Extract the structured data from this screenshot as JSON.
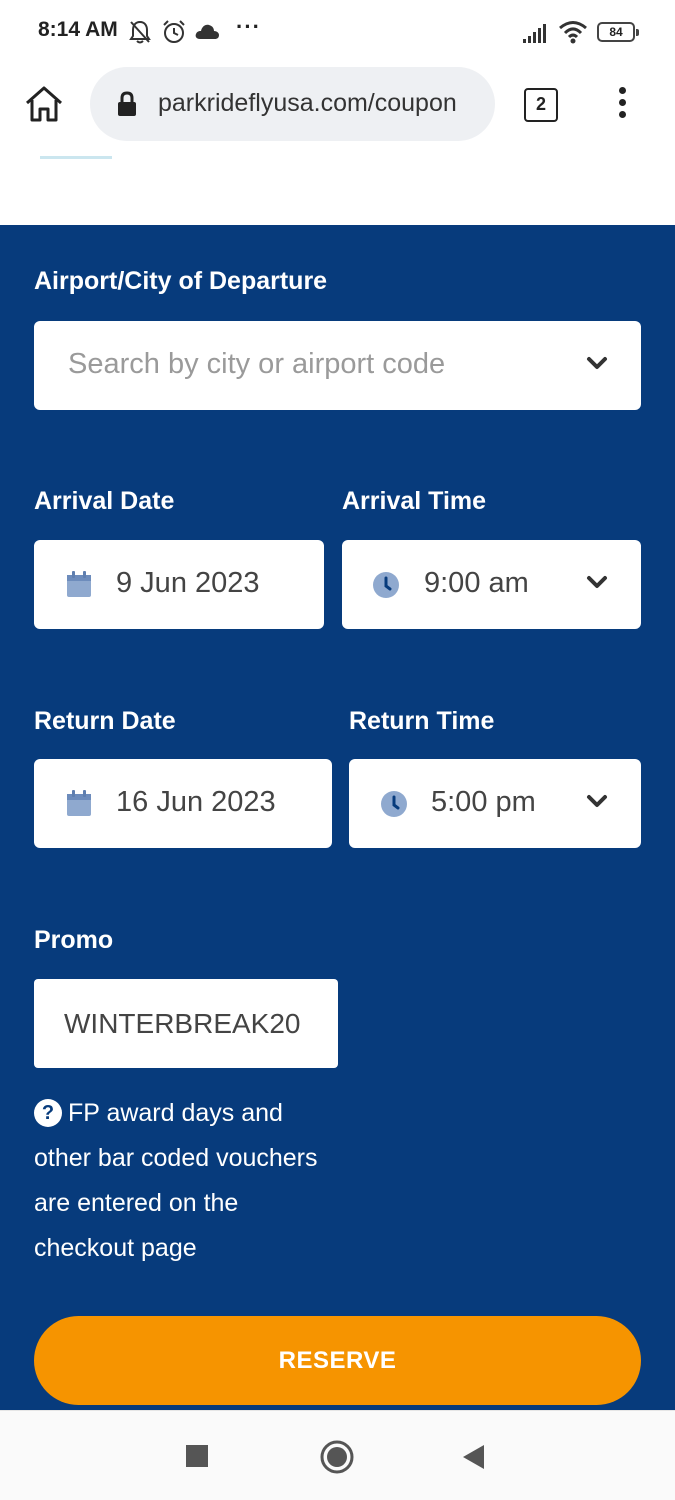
{
  "status_bar": {
    "time": "8:14 AM",
    "icons": [
      "notifications-off-icon",
      "alarm-icon",
      "cloud-icon"
    ],
    "more": "···",
    "battery": "84"
  },
  "browser": {
    "url": "parkrideflyusa.com/coupon",
    "tab_count": "2",
    "icons": [
      "home-icon",
      "lock-icon",
      "overflow-menu-icon"
    ]
  },
  "form": {
    "departure": {
      "label": "Airport/City of Departure",
      "placeholder": "Search by city or airport code"
    },
    "arrival_date": {
      "label": "Arrival Date",
      "value": "9 Jun 2023"
    },
    "arrival_time": {
      "label": "Arrival Time",
      "value": "9:00 am"
    },
    "return_date": {
      "label": "Return Date",
      "value": "16 Jun 2023"
    },
    "return_time": {
      "label": "Return Time",
      "value": "5:00 pm"
    },
    "promo": {
      "label": "Promo",
      "value": "WINTERBREAK20"
    },
    "help": {
      "icon": "?",
      "text": "FP award days and other bar coded vouchers are entered on the checkout page"
    },
    "reserve_label": "RESERVE"
  },
  "colors": {
    "panel": "#073b7c",
    "button": "#f69400",
    "icon_accent": "#8fa9cf"
  },
  "nav_bar": {
    "icons": [
      "recents-square-icon",
      "home-circle-icon",
      "back-triangle-icon"
    ]
  }
}
